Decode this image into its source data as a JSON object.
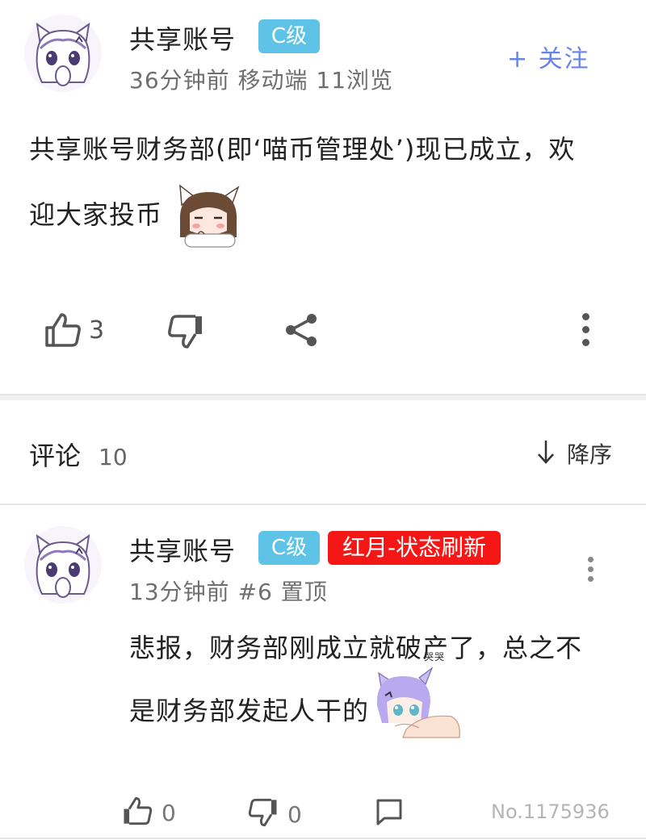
{
  "post": {
    "author": "共享账号",
    "level_badge": "C级",
    "meta": "36分钟前 移动端 11浏览",
    "follow_label": "+ 关注",
    "content_line1": "共享账号财务部(即‘喵币管理处’)现已成立，欢",
    "content_line2": "迎大家投币",
    "like_count": "3",
    "icons": [
      "thumbs-up-icon",
      "thumbs-down-icon",
      "share-icon",
      "more-vertical-icon"
    ]
  },
  "comments": {
    "title": "评论",
    "count": "10",
    "sort_label": "降序",
    "sort_icon": "arrow-down-icon",
    "items": [
      {
        "author": "共享账号",
        "level_badge": "C级",
        "title_badge": "红月-状态刷新",
        "meta": "13分钟前 #6 置顶",
        "content_line1": "悲报，财务部刚成立就破产了，总之不",
        "content_line2": "是财务部发起人干的",
        "like_count": "0",
        "dislike_count": "0",
        "comment_no": "No.1175936"
      }
    ]
  },
  "colors": {
    "level_badge": "#5ec3e7",
    "title_badge": "#f51616",
    "follow": "#6a83e8",
    "meta": "#6f6f6f"
  }
}
